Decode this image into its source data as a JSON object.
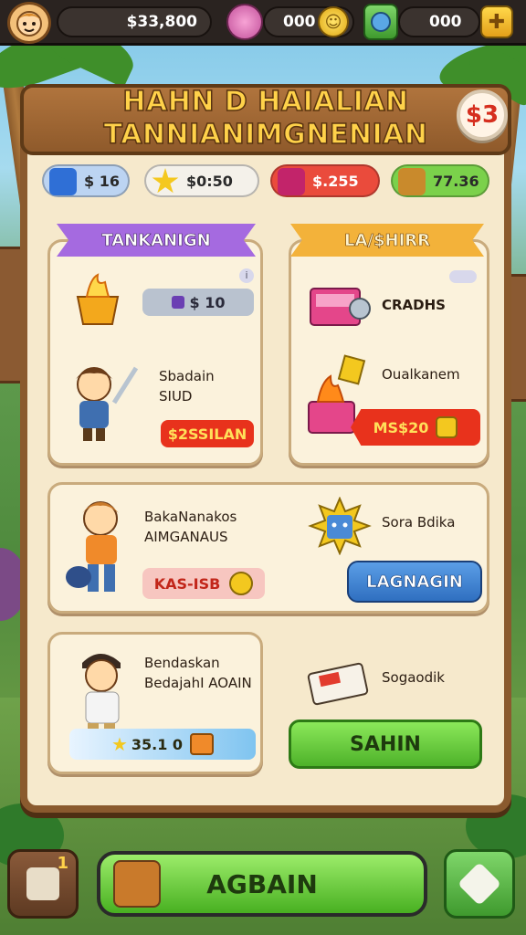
{
  "top_bar": {
    "coins_value": "$33,800",
    "gems_value": "000",
    "energy_value": "000"
  },
  "panel": {
    "title_line1": "HAHN  D HAIALIAN",
    "title_line2": "TANNIANIMGNENIAN",
    "close_label": "$3"
  },
  "resources": [
    {
      "value": "$ 16",
      "color": "#2f6fd6"
    },
    {
      "value": "$0:50",
      "color": "#f2f2f2"
    },
    {
      "value": "$.255",
      "color": "#e23b2e"
    },
    {
      "value": "77.36",
      "color": "#5fbf3a"
    }
  ],
  "section_left": {
    "ribbon": "TANKANIGN",
    "items": [
      {
        "icon": "flame-crate-icon",
        "price": "$ 10"
      },
      {
        "icon": "hero-swordsman-icon",
        "name_line1": "Sbadain",
        "name_line2": "SIUD",
        "price": "$2SSILAN"
      }
    ]
  },
  "section_right": {
    "ribbon": "LA/$HIRR",
    "items": [
      {
        "icon": "toolbox-icon",
        "name": "CRADHS"
      },
      {
        "icon": "fire-chest-icon",
        "name": "Oualkanem",
        "price": "MS$20"
      }
    ]
  },
  "row_two": {
    "hero_name_line1": "BakaNanakos",
    "hero_name_line2": "AIMGANAUS",
    "hero_price": "KAS-ISB",
    "bonus_icon": "sun-box-icon",
    "bonus_name": "Sora Bdika",
    "bonus_button": "LAGNAGIN"
  },
  "row_three": {
    "hero_name_line1": "Bendaskan",
    "hero_name_line2": "BedajahI AOAIN",
    "hero_price": "35.1 0",
    "pack_icon": "ticket-pack-icon",
    "pack_name": "Sogaodik",
    "pack_button": "SAHIN"
  },
  "bottom": {
    "left_badge": "1",
    "main_button": "AGBAIN"
  },
  "colors": {
    "wood": "#8a5a2e",
    "parchment": "#f6e9cc",
    "green_button": "#5cc23a",
    "blue_button": "#3a7fd0",
    "ribbon_purple": "#a56ae0",
    "ribbon_orange": "#f3b23a"
  }
}
